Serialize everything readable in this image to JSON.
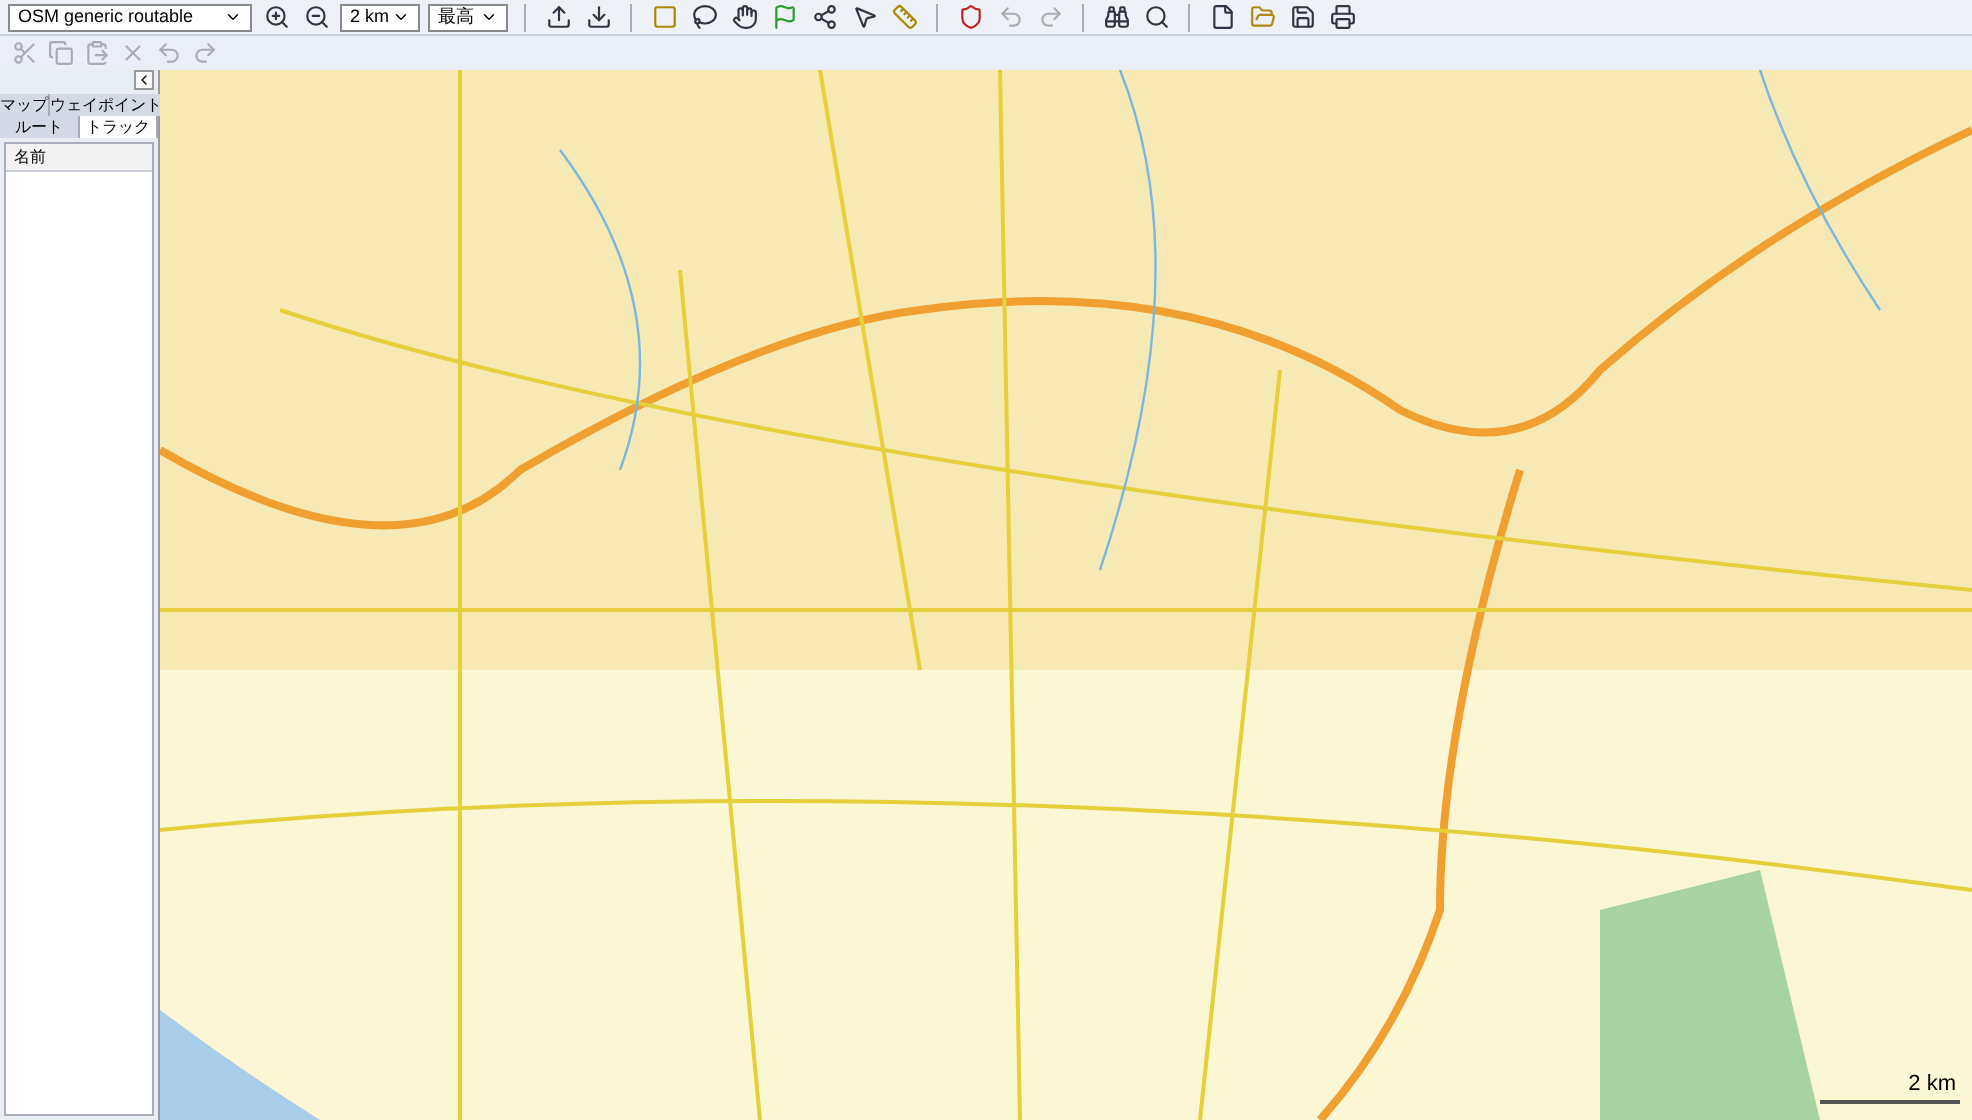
{
  "toolbar": {
    "map_product": "OSM generic routable",
    "zoom_scale": "2 km",
    "detail": "最高"
  },
  "tab_rows": [
    [
      {
        "label": "マップ",
        "selected": false
      },
      {
        "label": "ウェイポイント",
        "selected": false
      }
    ],
    [
      {
        "label": "ルート",
        "selected": false
      },
      {
        "label": "トラック",
        "selected": true
      }
    ]
  ],
  "list": {
    "columns": [
      "名前"
    ]
  },
  "map": {
    "scale_label": "2 km"
  }
}
